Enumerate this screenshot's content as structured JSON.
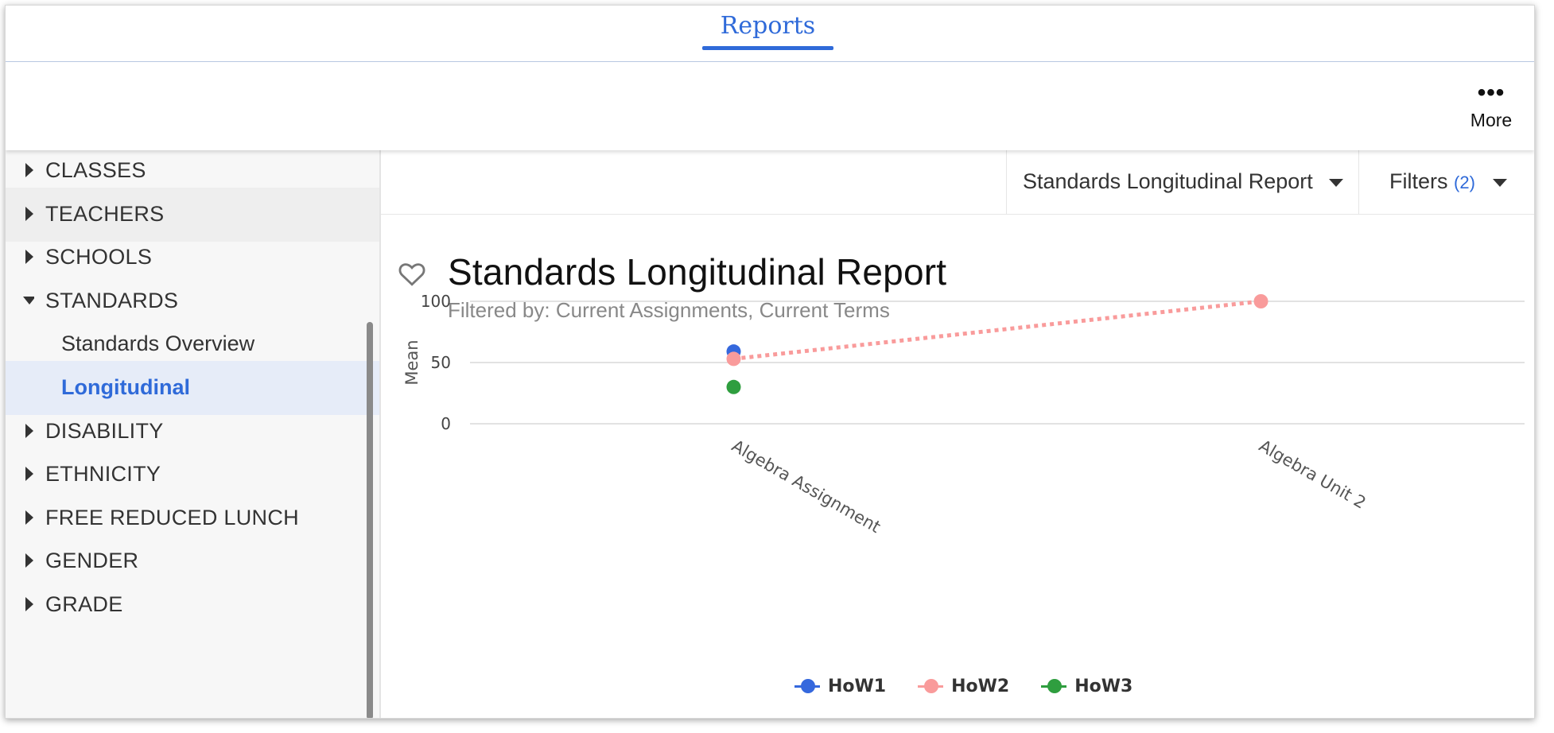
{
  "header": {
    "tab_label": "Reports",
    "more_label": "More"
  },
  "sidebar": {
    "items": [
      {
        "label": "CLASSES",
        "expanded": false
      },
      {
        "label": "TEACHERS",
        "expanded": false
      },
      {
        "label": "SCHOOLS",
        "expanded": false
      },
      {
        "label": "STANDARDS",
        "expanded": true
      },
      {
        "label": "Standards Overview",
        "sub": true
      },
      {
        "label": "Longitudinal",
        "sub": true,
        "active": true
      },
      {
        "label": "DISABILITY",
        "expanded": false
      },
      {
        "label": "ETHNICITY",
        "expanded": false
      },
      {
        "label": "FREE REDUCED LUNCH",
        "expanded": false
      },
      {
        "label": "GENDER",
        "expanded": false
      },
      {
        "label": "GRADE",
        "expanded": false
      }
    ]
  },
  "report_bar": {
    "report_select_label": "Standards Longitudinal Report",
    "filters_label": "Filters",
    "filters_count": "(2)"
  },
  "report": {
    "title": "Standards Longitudinal Report",
    "subtitle": "Filtered by: Current Assignments, Current Terms"
  },
  "colors": {
    "accent": "#2f6ad9",
    "how1": "#3568dd",
    "how2": "#f99b9b",
    "how3": "#2f9e3f"
  },
  "chart_data": {
    "type": "line",
    "categories": [
      "Algebra Assignment",
      "Algebra Unit 2"
    ],
    "ylabel": "Mean",
    "xlabel": "",
    "ylim": [
      0,
      100
    ],
    "yticks": [
      "0",
      "50",
      "100"
    ],
    "grid": true,
    "legend_position": "bottom",
    "series": [
      {
        "name": "HoW1",
        "values": [
          59,
          null
        ],
        "color": "#3568dd",
        "line": "none"
      },
      {
        "name": "HoW2",
        "values": [
          53,
          100
        ],
        "color": "#f99b9b",
        "line": "dotted"
      },
      {
        "name": "HoW3",
        "values": [
          30,
          null
        ],
        "color": "#2f9e3f",
        "line": "none"
      }
    ]
  }
}
